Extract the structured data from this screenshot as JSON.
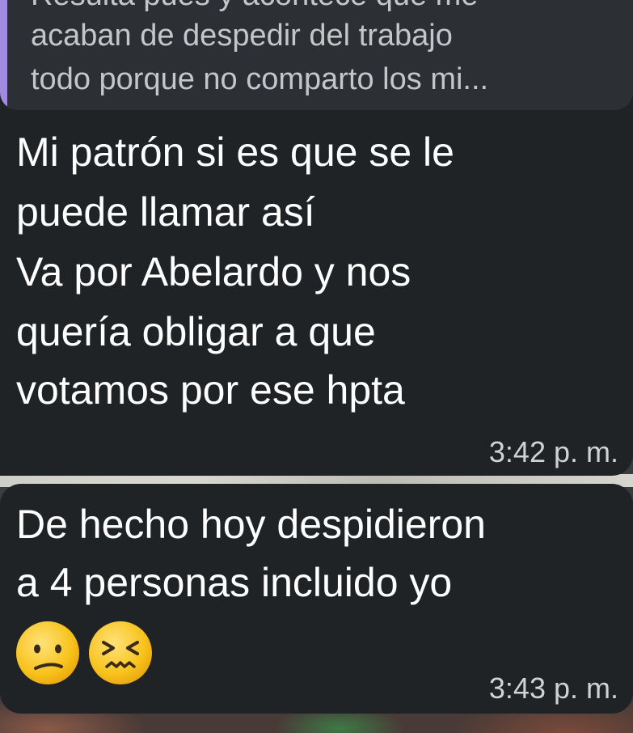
{
  "quoted_message": {
    "lines": [
      "Resulta pues y acontece que me",
      "acaban de despedir del trabajo",
      "todo porque no comparto los mi..."
    ]
  },
  "messages": [
    {
      "lines": [
        "Mi patrón si es que se le",
        "puede llamar así",
        "Va por Abelardo y nos",
        "quería obligar a que",
        "votamos por ese hpta"
      ],
      "time": "3:42 p. m."
    },
    {
      "lines": [
        "De hecho hoy despidieron",
        "a 4 personas incluido yo"
      ],
      "emojis": [
        "confused-face-emoji",
        "confounded-face-emoji"
      ],
      "time": "3:43 p. m."
    }
  ],
  "colors": {
    "bubble": "#1f2326",
    "quote_background": "#2c2f33",
    "quote_accent": "#a08be0",
    "text": "#ffffff",
    "emoji_face": "#f5c518"
  }
}
